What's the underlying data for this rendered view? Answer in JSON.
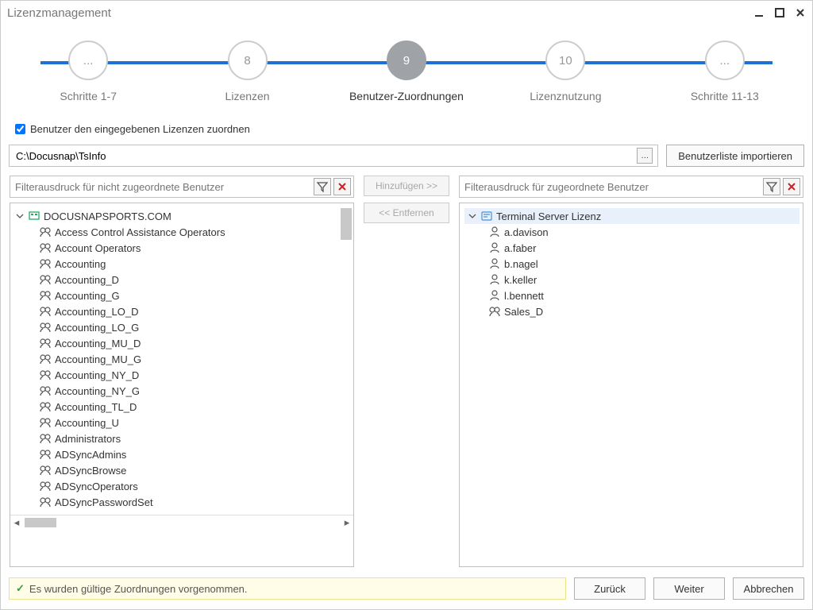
{
  "title": "Lizenzmanagement",
  "steps": [
    {
      "num": "...",
      "label": "Schritte 1-7"
    },
    {
      "num": "8",
      "label": "Lizenzen"
    },
    {
      "num": "9",
      "label": "Benutzer-Zuordnungen",
      "active": true
    },
    {
      "num": "10",
      "label": "Lizenznutzung"
    },
    {
      "num": "...",
      "label": "Schritte 11-13"
    }
  ],
  "assign_checkbox_label": "Benutzer den eingegebenen Lizenzen zuordnen",
  "path_value": "C:\\Docusnap\\TsInfo",
  "import_label": "Benutzerliste importieren",
  "left_filter_placeholder": "Filterausdruck für nicht zugeordnete Benutzer",
  "right_filter_placeholder": "Filterausdruck für zugeordnete Benutzer",
  "add_label": "Hinzufügen >>",
  "remove_label": "<< Entfernen",
  "left_root": "DOCUSNAPSPORTS.COM",
  "left_items": [
    "Access Control Assistance Operators",
    "Account Operators",
    "Accounting",
    "Accounting_D",
    "Accounting_G",
    "Accounting_LO_D",
    "Accounting_LO_G",
    "Accounting_MU_D",
    "Accounting_MU_G",
    "Accounting_NY_D",
    "Accounting_NY_G",
    "Accounting_TL_D",
    "Accounting_U",
    "Administrators",
    "ADSyncAdmins",
    "ADSyncBrowse",
    "ADSyncOperators",
    "ADSyncPasswordSet"
  ],
  "right_root": "Terminal Server Lizenz",
  "right_items": [
    "a.davison",
    "a.faber",
    "b.nagel",
    "k.keller",
    "l.bennett",
    "Sales_D"
  ],
  "right_group_items": [
    "Sales_D"
  ],
  "status_text": "Es wurden gültige Zuordnungen vorgenommen.",
  "back_label": "Zurück",
  "next_label": "Weiter",
  "cancel_label": "Abbrechen"
}
